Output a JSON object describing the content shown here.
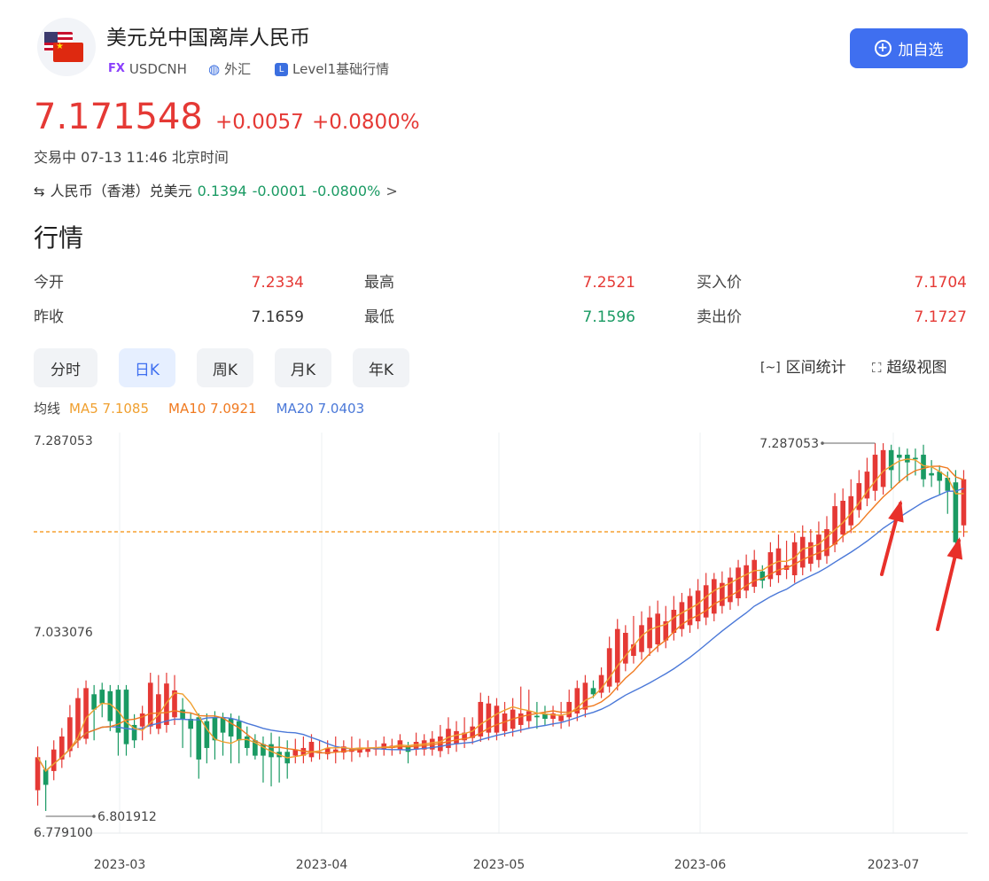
{
  "header": {
    "title": "美元兑中国离岸人民币",
    "market_tag": "FX",
    "symbol": "USDCNH",
    "category": "外汇",
    "level": "Level1基础行情",
    "add_button": "加自选"
  },
  "quote": {
    "price": "7.171548",
    "change": "+0.0057",
    "change_pct": "+0.0800%",
    "status": "交易中 07-13 11:46 北京时间"
  },
  "reverse": {
    "name": "人民币（香港）兑美元",
    "price": "0.1394",
    "change": "-0.0001",
    "change_pct": "-0.0800%",
    "arrow": ">"
  },
  "section_title": "行情",
  "stats": {
    "open_label": "今开",
    "open": "7.2334",
    "high_label": "最高",
    "high": "7.2521",
    "bid_label": "买入价",
    "bid": "7.1704",
    "prev_label": "昨收",
    "prev": "7.1659",
    "low_label": "最低",
    "low": "7.1596",
    "ask_label": "卖出价",
    "ask": "7.1727"
  },
  "tabs": [
    "分时",
    "日K",
    "周K",
    "月K",
    "年K"
  ],
  "active_tab": 1,
  "tools": {
    "range_stats": "区间统计",
    "super_view": "超级视图"
  },
  "ma": {
    "label": "均线",
    "ma5": "MA5 7.1085",
    "ma10": "MA10 7.0921",
    "ma20": "MA20 7.0403"
  },
  "colors": {
    "up": "#e53935",
    "down": "#1a9a63",
    "ma5": "#f0a030",
    "ma10": "#f07a20",
    "ma20": "#4a78d8",
    "accent": "#3f6ff0"
  },
  "chart_data": {
    "type": "candlestick",
    "y_axis_labels": [
      "7.287053",
      "7.033076",
      "6.779100"
    ],
    "ylim": [
      6.7791,
      7.287053
    ],
    "x_tick_labels": [
      "2023-03",
      "2023-04",
      "2023-05",
      "2023-06",
      "2023-07"
    ],
    "max_annotation": "7.287053",
    "min_annotation": "6.801912",
    "current_price_line": 7.1716,
    "candles": [
      {
        "o": 6.835,
        "c": 6.878,
        "h": 6.892,
        "l": 6.815
      },
      {
        "o": 6.862,
        "c": 6.842,
        "h": 6.874,
        "l": 6.808
      },
      {
        "o": 6.86,
        "c": 6.888,
        "h": 6.9,
        "l": 6.848
      },
      {
        "o": 6.875,
        "c": 6.905,
        "h": 6.916,
        "l": 6.864
      },
      {
        "o": 6.886,
        "c": 6.93,
        "h": 6.946,
        "l": 6.878
      },
      {
        "o": 6.9,
        "c": 6.955,
        "h": 6.968,
        "l": 6.89
      },
      {
        "o": 6.902,
        "c": 6.968,
        "h": 6.978,
        "l": 6.895
      },
      {
        "o": 6.96,
        "c": 6.94,
        "h": 6.972,
        "l": 6.9
      },
      {
        "o": 6.966,
        "c": 6.948,
        "h": 6.975,
        "l": 6.93
      },
      {
        "o": 6.964,
        "c": 6.925,
        "h": 6.972,
        "l": 6.912
      },
      {
        "o": 6.966,
        "c": 6.91,
        "h": 6.972,
        "l": 6.88
      },
      {
        "o": 6.966,
        "c": 6.895,
        "h": 6.972,
        "l": 6.88
      },
      {
        "o": 6.92,
        "c": 6.9,
        "h": 6.934,
        "l": 6.89
      },
      {
        "o": 6.918,
        "c": 6.935,
        "h": 6.945,
        "l": 6.9
      },
      {
        "o": 6.918,
        "c": 6.975,
        "h": 6.988,
        "l": 6.908
      },
      {
        "o": 6.915,
        "c": 6.96,
        "h": 6.985,
        "l": 6.908
      },
      {
        "o": 6.92,
        "c": 6.974,
        "h": 6.988,
        "l": 6.91
      },
      {
        "o": 6.93,
        "c": 6.965,
        "h": 6.985,
        "l": 6.92
      },
      {
        "o": 6.94,
        "c": 6.928,
        "h": 6.955,
        "l": 6.89
      },
      {
        "o": 6.928,
        "c": 6.915,
        "h": 6.935,
        "l": 6.878
      },
      {
        "o": 6.93,
        "c": 6.875,
        "h": 6.935,
        "l": 6.85
      },
      {
        "o": 6.925,
        "c": 6.89,
        "h": 6.935,
        "l": 6.87
      },
      {
        "o": 6.93,
        "c": 6.9,
        "h": 6.938,
        "l": 6.875
      },
      {
        "o": 6.93,
        "c": 6.91,
        "h": 6.936,
        "l": 6.88
      },
      {
        "o": 6.928,
        "c": 6.905,
        "h": 6.935,
        "l": 6.87
      },
      {
        "o": 6.925,
        "c": 6.9,
        "h": 6.932,
        "l": 6.87
      },
      {
        "o": 6.905,
        "c": 6.89,
        "h": 6.918,
        "l": 6.88
      },
      {
        "o": 6.9,
        "c": 6.88,
        "h": 6.908,
        "l": 6.875
      },
      {
        "o": 6.895,
        "c": 6.88,
        "h": 6.905,
        "l": 6.845
      },
      {
        "o": 6.895,
        "c": 6.878,
        "h": 6.91,
        "l": 6.84
      },
      {
        "o": 6.885,
        "c": 6.878,
        "h": 6.905,
        "l": 6.845
      },
      {
        "o": 6.885,
        "c": 6.87,
        "h": 6.9,
        "l": 6.85
      },
      {
        "o": 6.88,
        "c": 6.888,
        "h": 6.902,
        "l": 6.87
      },
      {
        "o": 6.88,
        "c": 6.89,
        "h": 6.905,
        "l": 6.87
      },
      {
        "o": 6.878,
        "c": 6.898,
        "h": 6.908,
        "l": 6.872
      },
      {
        "o": 6.884,
        "c": 6.885,
        "h": 6.9,
        "l": 6.875
      },
      {
        "o": 6.882,
        "c": 6.89,
        "h": 6.9,
        "l": 6.875
      },
      {
        "o": 6.885,
        "c": 6.888,
        "h": 6.905,
        "l": 6.87
      },
      {
        "o": 6.884,
        "c": 6.892,
        "h": 6.9,
        "l": 6.875
      },
      {
        "o": 6.885,
        "c": 6.89,
        "h": 6.905,
        "l": 6.872
      },
      {
        "o": 6.884,
        "c": 6.89,
        "h": 6.902,
        "l": 6.878
      },
      {
        "o": 6.885,
        "c": 6.889,
        "h": 6.9,
        "l": 6.878
      },
      {
        "o": 6.888,
        "c": 6.891,
        "h": 6.9,
        "l": 6.88
      },
      {
        "o": 6.889,
        "c": 6.896,
        "h": 6.905,
        "l": 6.88
      },
      {
        "o": 6.89,
        "c": 6.893,
        "h": 6.902,
        "l": 6.88
      },
      {
        "o": 6.888,
        "c": 6.9,
        "h": 6.908,
        "l": 6.882
      },
      {
        "o": 6.893,
        "c": 6.885,
        "h": 6.898,
        "l": 6.87
      },
      {
        "o": 6.888,
        "c": 6.898,
        "h": 6.91,
        "l": 6.88
      },
      {
        "o": 6.888,
        "c": 6.9,
        "h": 6.908,
        "l": 6.88
      },
      {
        "o": 6.888,
        "c": 6.902,
        "h": 6.912,
        "l": 6.88
      },
      {
        "o": 6.886,
        "c": 6.905,
        "h": 6.92,
        "l": 6.878
      },
      {
        "o": 6.89,
        "c": 6.915,
        "h": 6.93,
        "l": 6.882
      },
      {
        "o": 6.895,
        "c": 6.912,
        "h": 6.925,
        "l": 6.885
      },
      {
        "o": 6.9,
        "c": 6.91,
        "h": 6.93,
        "l": 6.89
      },
      {
        "o": 6.903,
        "c": 6.918,
        "h": 6.93,
        "l": 6.895
      },
      {
        "o": 6.905,
        "c": 6.95,
        "h": 6.962,
        "l": 6.898
      },
      {
        "o": 6.91,
        "c": 6.948,
        "h": 6.958,
        "l": 6.9
      },
      {
        "o": 6.91,
        "c": 6.945,
        "h": 6.955,
        "l": 6.9
      },
      {
        "o": 6.912,
        "c": 6.935,
        "h": 6.95,
        "l": 6.905
      },
      {
        "o": 6.915,
        "c": 6.94,
        "h": 6.955,
        "l": 6.905
      },
      {
        "o": 6.92,
        "c": 6.935,
        "h": 6.97,
        "l": 6.91
      },
      {
        "o": 6.925,
        "c": 6.938,
        "h": 6.966,
        "l": 6.915
      },
      {
        "o": 6.932,
        "c": 6.93,
        "h": 6.95,
        "l": 6.915
      },
      {
        "o": 6.935,
        "c": 6.928,
        "h": 6.945,
        "l": 6.92
      },
      {
        "o": 6.928,
        "c": 6.935,
        "h": 6.945,
        "l": 6.918
      },
      {
        "o": 6.925,
        "c": 6.932,
        "h": 6.95,
        "l": 6.915
      },
      {
        "o": 6.93,
        "c": 6.95,
        "h": 6.966,
        "l": 6.918
      },
      {
        "o": 6.935,
        "c": 6.968,
        "h": 6.978,
        "l": 6.925
      },
      {
        "o": 6.94,
        "c": 6.975,
        "h": 6.985,
        "l": 6.93
      },
      {
        "o": 6.968,
        "c": 6.96,
        "h": 6.978,
        "l": 6.955
      },
      {
        "o": 6.962,
        "c": 6.985,
        "h": 6.995,
        "l": 6.955
      },
      {
        "o": 6.97,
        "c": 7.02,
        "h": 7.035,
        "l": 6.962
      },
      {
        "o": 6.975,
        "c": 7.045,
        "h": 7.058,
        "l": 6.965
      },
      {
        "o": 7.0,
        "c": 7.04,
        "h": 7.05,
        "l": 6.99
      },
      {
        "o": 7.01,
        "c": 7.025,
        "h": 7.062,
        "l": 7.0
      },
      {
        "o": 7.015,
        "c": 7.05,
        "h": 7.068,
        "l": 7.005
      },
      {
        "o": 7.02,
        "c": 7.06,
        "h": 7.075,
        "l": 7.01
      },
      {
        "o": 7.025,
        "c": 7.065,
        "h": 7.082,
        "l": 7.015
      },
      {
        "o": 7.03,
        "c": 7.055,
        "h": 7.075,
        "l": 7.02
      },
      {
        "o": 7.04,
        "c": 7.07,
        "h": 7.088,
        "l": 7.03
      },
      {
        "o": 7.045,
        "c": 7.08,
        "h": 7.092,
        "l": 7.035
      },
      {
        "o": 7.05,
        "c": 7.088,
        "h": 7.098,
        "l": 7.04
      },
      {
        "o": 7.055,
        "c": 7.095,
        "h": 7.11,
        "l": 7.045
      },
      {
        "o": 7.06,
        "c": 7.102,
        "h": 7.118,
        "l": 7.05
      },
      {
        "o": 7.065,
        "c": 7.11,
        "h": 7.118,
        "l": 7.055
      },
      {
        "o": 7.075,
        "c": 7.105,
        "h": 7.12,
        "l": 7.065
      },
      {
        "o": 7.08,
        "c": 7.112,
        "h": 7.125,
        "l": 7.07
      },
      {
        "o": 7.085,
        "c": 7.125,
        "h": 7.135,
        "l": 7.075
      },
      {
        "o": 7.095,
        "c": 7.128,
        "h": 7.142,
        "l": 7.085
      },
      {
        "o": 7.1,
        "c": 7.135,
        "h": 7.148,
        "l": 7.092
      },
      {
        "o": 7.12,
        "c": 7.108,
        "h": 7.128,
        "l": 7.098
      },
      {
        "o": 7.11,
        "c": 7.145,
        "h": 7.158,
        "l": 7.1
      },
      {
        "o": 7.115,
        "c": 7.15,
        "h": 7.168,
        "l": 7.105
      },
      {
        "o": 7.122,
        "c": 7.128,
        "h": 7.16,
        "l": 7.11
      },
      {
        "o": 7.115,
        "c": 7.158,
        "h": 7.17,
        "l": 7.105
      },
      {
        "o": 7.125,
        "c": 7.165,
        "h": 7.18,
        "l": 7.115
      },
      {
        "o": 7.13,
        "c": 7.158,
        "h": 7.175,
        "l": 7.12
      },
      {
        "o": 7.135,
        "c": 7.168,
        "h": 7.185,
        "l": 7.125
      },
      {
        "o": 7.14,
        "c": 7.175,
        "h": 7.192,
        "l": 7.13
      },
      {
        "o": 7.155,
        "c": 7.205,
        "h": 7.222,
        "l": 7.145
      },
      {
        "o": 7.168,
        "c": 7.212,
        "h": 7.228,
        "l": 7.158
      },
      {
        "o": 7.18,
        "c": 7.218,
        "h": 7.24,
        "l": 7.17
      },
      {
        "o": 7.2,
        "c": 7.235,
        "h": 7.252,
        "l": 7.19
      },
      {
        "o": 7.215,
        "c": 7.25,
        "h": 7.268,
        "l": 7.205
      },
      {
        "o": 7.225,
        "c": 7.272,
        "h": 7.287,
        "l": 7.212
      },
      {
        "o": 7.23,
        "c": 7.278,
        "h": 7.287,
        "l": 7.22
      },
      {
        "o": 7.278,
        "c": 7.252,
        "h": 7.285,
        "l": 7.228
      },
      {
        "o": 7.272,
        "c": 7.268,
        "h": 7.282,
        "l": 7.235
      },
      {
        "o": 7.272,
        "c": 7.262,
        "h": 7.28,
        "l": 7.238
      },
      {
        "o": 7.268,
        "c": 7.266,
        "h": 7.28,
        "l": 7.245
      },
      {
        "o": 7.272,
        "c": 7.24,
        "h": 7.285,
        "l": 7.23
      },
      {
        "o": 7.248,
        "c": 7.245,
        "h": 7.265,
        "l": 7.23
      },
      {
        "o": 7.25,
        "c": 7.238,
        "h": 7.258,
        "l": 7.22
      },
      {
        "o": 7.242,
        "c": 7.225,
        "h": 7.25,
        "l": 7.195
      },
      {
        "o": 7.236,
        "c": 7.158,
        "h": 7.252,
        "l": 7.15
      },
      {
        "o": 7.18,
        "c": 7.24,
        "h": 7.252,
        "l": 7.165
      }
    ]
  }
}
